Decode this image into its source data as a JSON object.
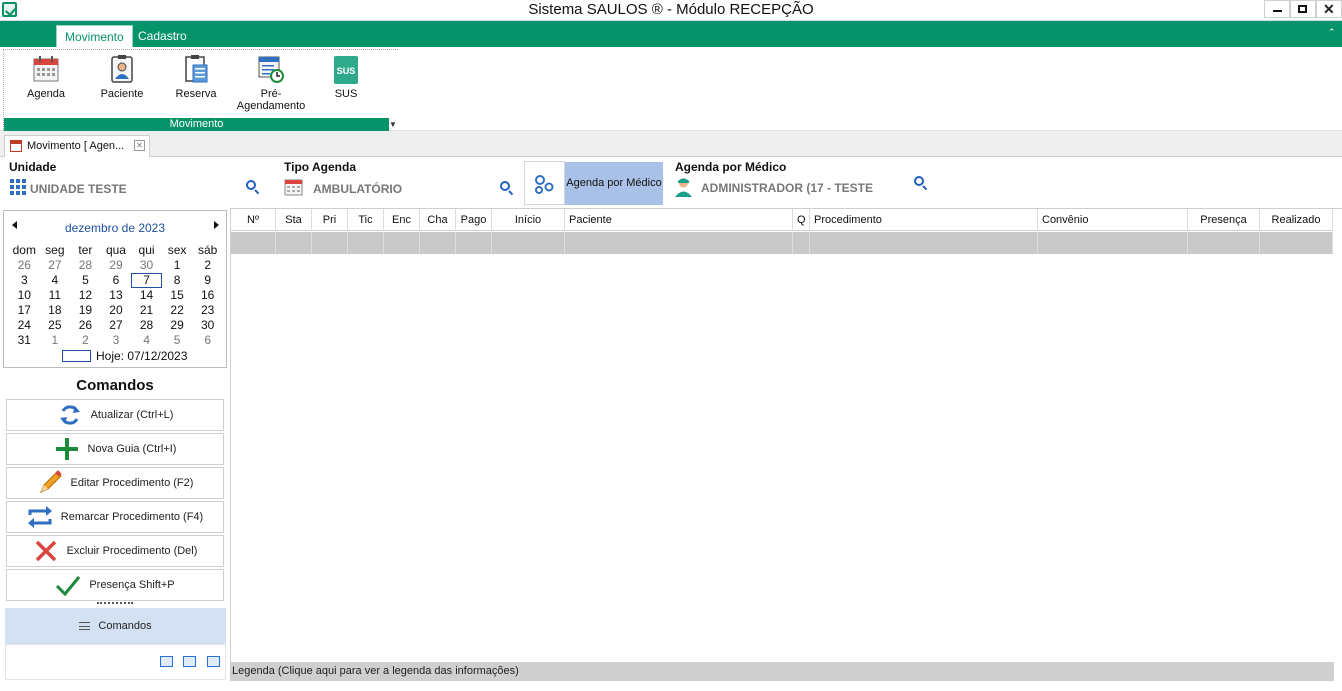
{
  "window": {
    "title": "Sistema SAULOS ® - Módulo RECEPÇÃO"
  },
  "ribbon_tabs": [
    {
      "label": "Movimento",
      "active": true
    },
    {
      "label": "Cadastro",
      "active": false
    }
  ],
  "ribbon_buttons": {
    "agenda": "Agenda",
    "paciente": "Paciente",
    "reserva": "Reserva",
    "pre_agendamento_1": "Pré-",
    "pre_agendamento_2": "Agendamento",
    "sus": "SUS",
    "sus_icon_text": "SUS"
  },
  "ribbon_group_label": "Movimento",
  "doc_tab": {
    "label": "Movimento [ Agen..."
  },
  "filters": {
    "unidade_label": "Unidade",
    "unidade_value": "UNIDADE TESTE",
    "tipo_agenda_label": "Tipo Agenda",
    "tipo_agenda_value": "AMBULATÓRIO",
    "agenda_por_medico_button": "Agenda por Médico",
    "agenda_medico_label": "Agenda por Médico",
    "agenda_medico_value": "ADMINISTRADOR (17 - TESTE"
  },
  "calendar": {
    "month": "dezembro de 2023",
    "weekdays": [
      "dom",
      "seg",
      "ter",
      "qua",
      "qui",
      "sex",
      "sáb"
    ],
    "weeks": [
      [
        "26",
        "27",
        "28",
        "29",
        "30",
        "1",
        "2"
      ],
      [
        "3",
        "4",
        "5",
        "6",
        "7",
        "8",
        "9"
      ],
      [
        "10",
        "11",
        "12",
        "13",
        "14",
        "15",
        "16"
      ],
      [
        "17",
        "18",
        "19",
        "20",
        "21",
        "22",
        "23"
      ],
      [
        "24",
        "25",
        "26",
        "27",
        "28",
        "29",
        "30"
      ],
      [
        "31",
        "1",
        "2",
        "3",
        "4",
        "5",
        "6"
      ]
    ],
    "today_label": "Hoje: 07/12/2023"
  },
  "commands": {
    "title": "Comandos",
    "atualizar": "Atualizar (Ctrl+L)",
    "nova_guia": "Nova Guia (Ctrl+I)",
    "editar": "Editar Procedimento (F2)",
    "remarcar": "Remarcar Procedimento (F4)",
    "excluir": "Excluir Procedimento (Del)",
    "presenca": "Presença Shift+P",
    "nav_label": "Comandos"
  },
  "grid": {
    "columns": [
      "Nº",
      "Sta",
      "Pri",
      "Tic",
      "Enc",
      "Cha",
      "Pago",
      "Início",
      "Paciente",
      "Q",
      "Procedimento",
      "Convênio",
      "Presença",
      "Realizado"
    ]
  },
  "legend": "Legenda (Clique aqui para ver a legenda das informações)",
  "colors": {
    "brand": "#05936a",
    "accent_blue": "#1e4fa0",
    "selected_button": "#a9c1e6"
  }
}
